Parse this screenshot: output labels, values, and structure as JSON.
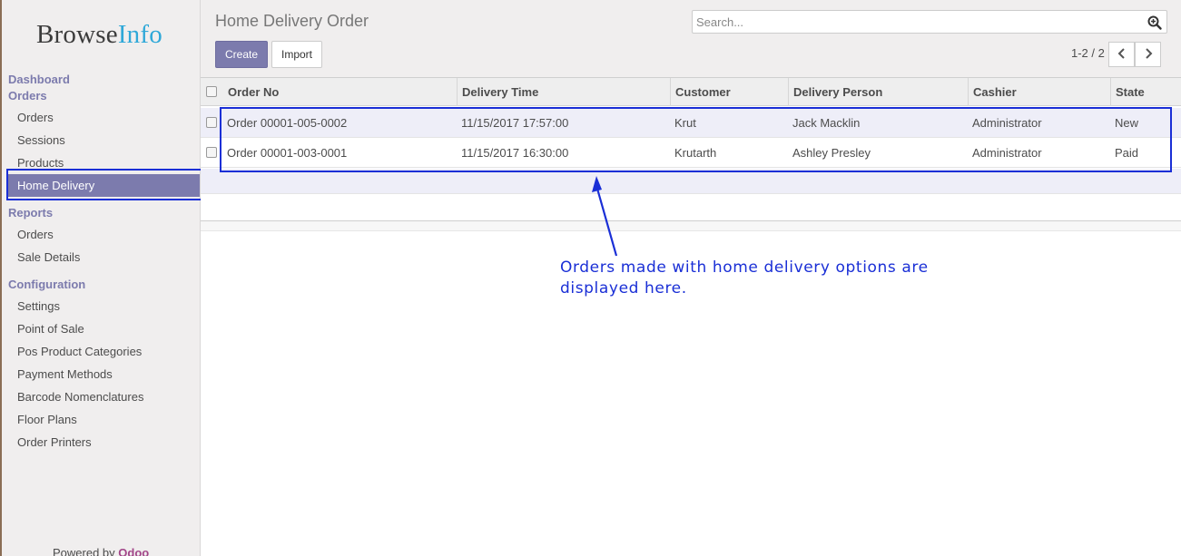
{
  "sidebar": {
    "logo": {
      "part1": "Browse",
      "part2": "Info"
    },
    "sections": {
      "dashboard": "Dashboard",
      "orders": "Orders",
      "reports": "Reports",
      "configuration": "Configuration"
    },
    "orders_items": [
      "Orders",
      "Sessions",
      "Products",
      "Home Delivery"
    ],
    "reports_items": [
      "Orders",
      "Sale Details"
    ],
    "config_items": [
      "Settings",
      "Point of Sale",
      "Pos Product Categories",
      "Payment Methods",
      "Barcode Nomenclatures",
      "Floor Plans",
      "Order Printers"
    ],
    "active": "Home Delivery",
    "powered_prefix": "Powered by ",
    "powered_brand": "Odoo"
  },
  "header": {
    "title": "Home Delivery Order",
    "create_label": "Create",
    "import_label": "Import",
    "search_placeholder": "Search...",
    "pager": "1-2 / 2"
  },
  "table": {
    "columns": [
      "Order No",
      "Delivery Time",
      "Customer",
      "Delivery Person",
      "Cashier",
      "State"
    ],
    "rows": [
      [
        "Order 00001-005-0002",
        "11/15/2017 17:57:00",
        "Krut",
        "Jack Macklin",
        "Administrator",
        "New"
      ],
      [
        "Order 00001-003-0001",
        "11/15/2017 16:30:00",
        "Krutarth",
        "Ashley Presley",
        "Administrator",
        "Paid"
      ]
    ]
  },
  "annotation": {
    "text": "Orders made with home delivery options are displayed here."
  },
  "colors": {
    "accent": "#7c7bad",
    "annotation": "#1a2fd6",
    "logo_info": "#2fa8d8",
    "odoo": "#a24689"
  },
  "icons": {
    "search": "search-icon",
    "prev": "chevron-left-icon",
    "next": "chevron-right-icon"
  }
}
